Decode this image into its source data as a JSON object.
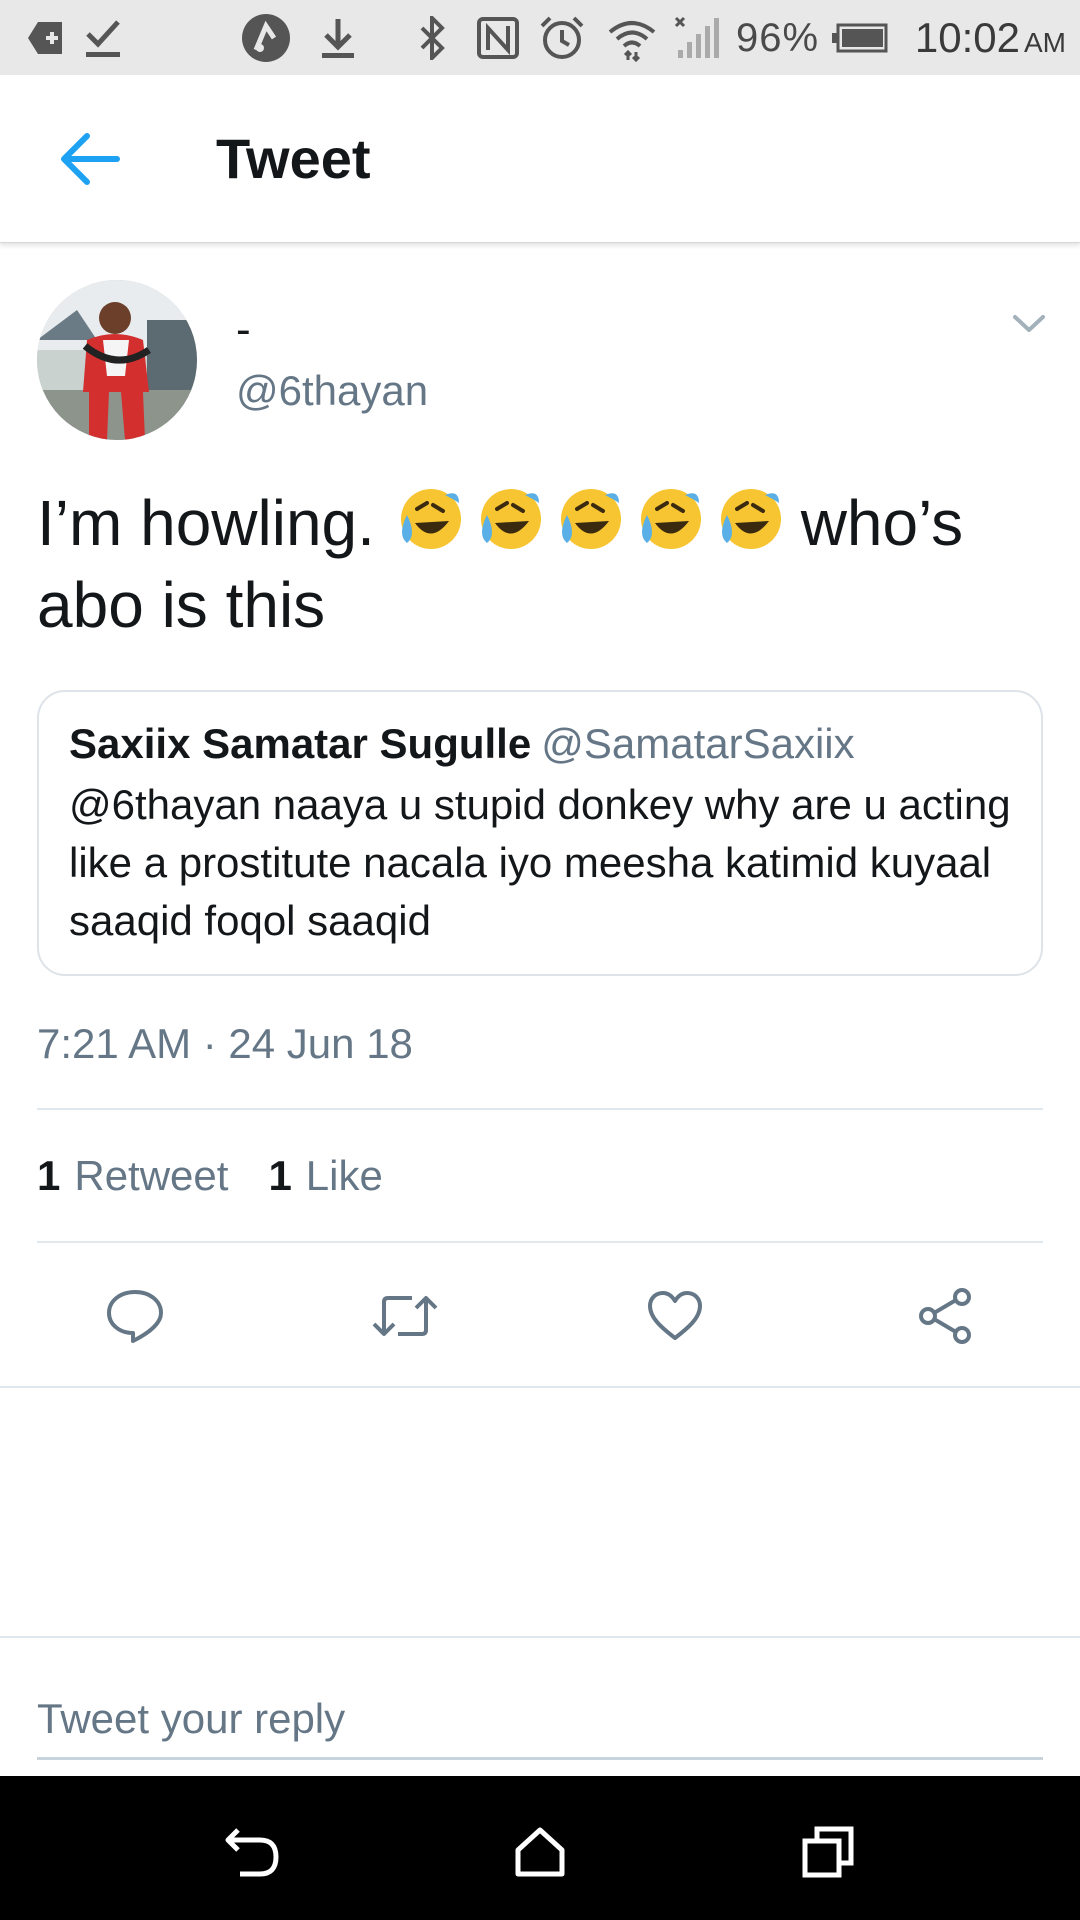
{
  "status_bar": {
    "battery": "96%",
    "time": "10:02",
    "ampm": "AM",
    "icons": [
      "add-box-icon",
      "checkmark-icon",
      "app-notification-icon",
      "download-icon",
      "bluetooth-icon",
      "nfc-icon",
      "alarm-icon",
      "wifi-icon",
      "cell-signal-icon",
      "battery-icon"
    ]
  },
  "header": {
    "back_icon": "arrow-left-icon",
    "title": "Tweet"
  },
  "tweet": {
    "display_name": "-",
    "handle": "@6thayan",
    "text_before": "I’m howling.",
    "emoji": [
      "rolling-laughing-emoji",
      "rolling-laughing-emoji",
      "rolling-laughing-emoji",
      "rolling-laughing-emoji",
      "rolling-laughing-emoji"
    ],
    "text_after": "who’s abo is this",
    "timestamp": "7:21 AM · 24 Jun 18"
  },
  "quoted_tweet": {
    "name": "Saxiix Samatar Sugulle",
    "handle": "@SamatarSaxiix",
    "text": "@6thayan naaya u stupid donkey why are u acting like a prostitute nacala iyo meesha katimid kuyaal saaqid foqol saaqid"
  },
  "stats": {
    "retweets_count": "1",
    "retweets_label": "Retweet",
    "likes_count": "1",
    "likes_label": "Like"
  },
  "actions": [
    "reply-icon",
    "retweet-icon",
    "heart-icon",
    "share-icon"
  ],
  "reply": {
    "placeholder": "Tweet your reply"
  },
  "nav_bar": [
    "back-icon",
    "home-icon",
    "recents-icon"
  ],
  "colors": {
    "accent": "#1da1f2",
    "text": "#14171a",
    "secondary": "#657786",
    "divider": "#e1e8ed"
  }
}
